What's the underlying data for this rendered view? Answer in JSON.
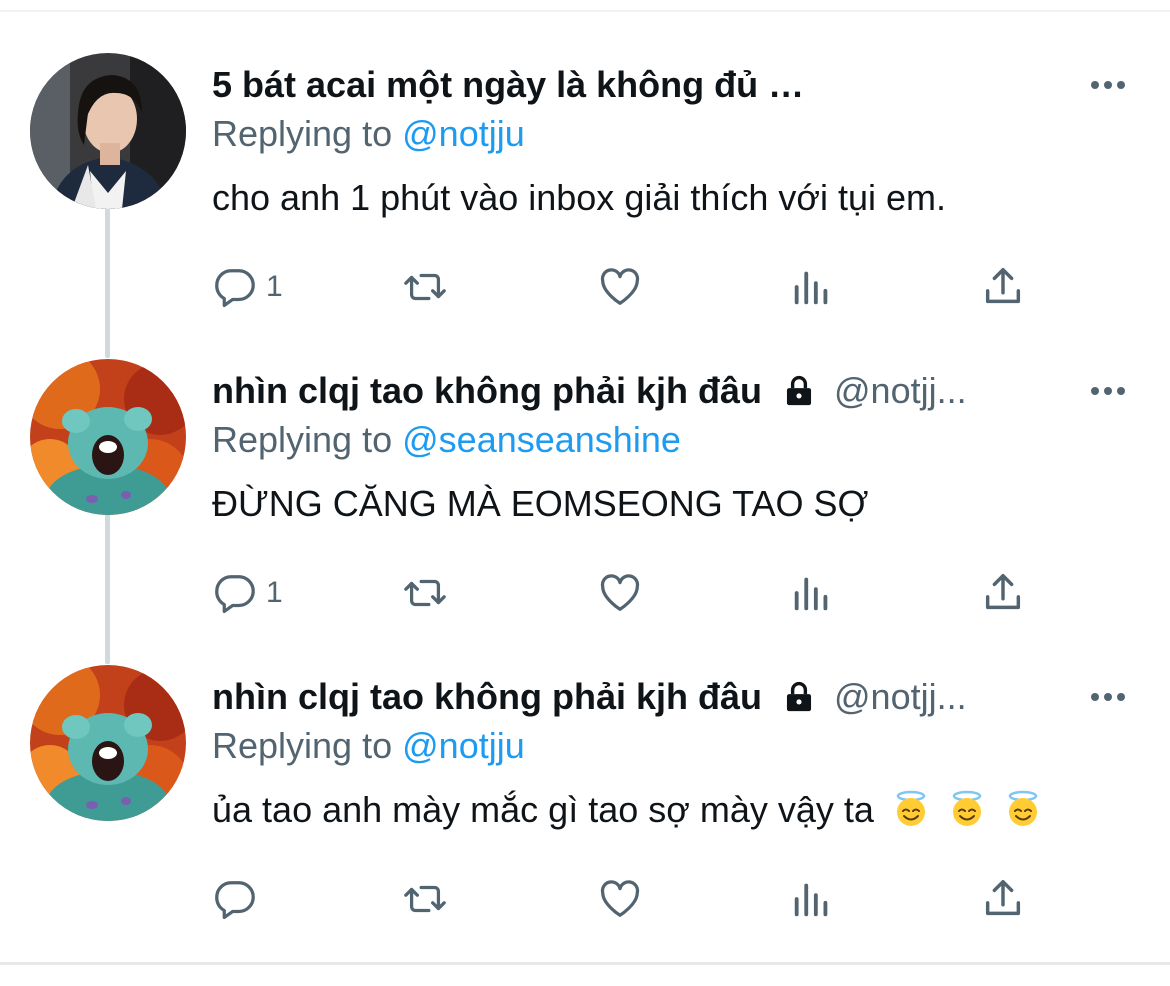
{
  "tweets": [
    {
      "author_name": "5 bát acai một ngày là không đủ …",
      "author_handle": "",
      "locked": false,
      "avatar": "portrait-photo",
      "replying_label": "Replying to",
      "replying_to": "@notjju",
      "text": "cho anh 1 phút vào inbox giải thích với tụi em.",
      "emojis": [],
      "actions": {
        "reply_count": "1",
        "retweet_count": "",
        "like_count": ""
      }
    },
    {
      "author_name": "nhìn clqj tao không phải kjh đâu",
      "author_handle": "@notjj...",
      "locked": true,
      "avatar": "blue-creature-fire",
      "replying_label": "Replying to",
      "replying_to": "@seanseanshine",
      "text": "ĐỪNG CĂNG MÀ EOMSEONG TAO SỢ",
      "emojis": [],
      "actions": {
        "reply_count": "1",
        "retweet_count": "",
        "like_count": ""
      }
    },
    {
      "author_name": "nhìn clqj tao không phải kjh đâu",
      "author_handle": "@notjj...",
      "locked": true,
      "avatar": "blue-creature-fire",
      "replying_label": "Replying to",
      "replying_to": "@notjju",
      "text": "ủa tao anh mày mắc gì tao sợ mày vậy ta",
      "emojis": [
        "smiling-face-with-halo",
        "smiling-face-with-halo",
        "smiling-face-with-halo"
      ],
      "actions": {
        "reply_count": "",
        "retweet_count": "",
        "like_count": ""
      }
    }
  ],
  "icons": {
    "reply": "reply-icon",
    "retweet": "retweet-icon",
    "like": "heart-icon",
    "views": "analytics-icon",
    "share": "share-icon",
    "more": "more-icon",
    "lock": "lock-icon"
  },
  "colors": {
    "accent": "#1d9bf0",
    "secondary_text": "#536471",
    "primary_text": "#0f1419",
    "thread_line": "#cfd9de"
  }
}
